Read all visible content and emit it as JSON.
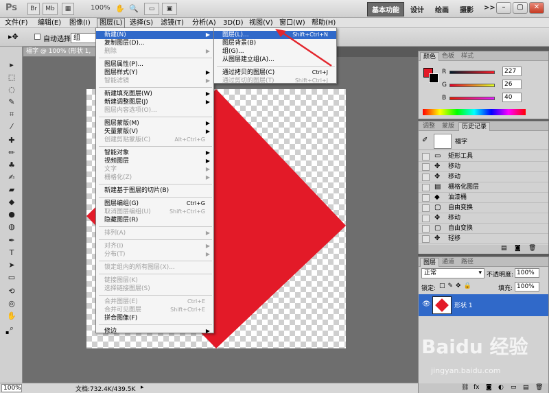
{
  "app": {
    "logo": "Ps",
    "zoom": "100%",
    "workspaces": [
      "基本功能",
      "设计",
      "绘画",
      "摄影"
    ],
    "more": ">>"
  },
  "menubar": [
    "文件(F)",
    "编辑(E)",
    "图像(I)",
    "图层(L)",
    "选择(S)",
    "滤镜(T)",
    "分析(A)",
    "3D(D)",
    "视图(V)",
    "窗口(W)",
    "帮助(H)"
  ],
  "options": {
    "auto_select_label": "自动选择:",
    "auto_select_value": "组"
  },
  "document": {
    "tab_title": "福字 @ 100% (形状 1,",
    "zoom": "100%",
    "doc_info": "文档:732.4K/439.5K"
  },
  "layer_menu": [
    {
      "label": "新建(N)",
      "arrow": true,
      "highlight": true
    },
    {
      "label": "复制图层(D)..."
    },
    {
      "label": "删除",
      "arrow": true,
      "disabled": true
    },
    {
      "sep": true
    },
    {
      "label": "图层属性(P)..."
    },
    {
      "label": "图层样式(Y)",
      "arrow": true
    },
    {
      "label": "智能滤镜",
      "arrow": true,
      "disabled": true
    },
    {
      "sep": true
    },
    {
      "label": "新建填充图层(W)",
      "arrow": true
    },
    {
      "label": "新建调整图层(J)",
      "arrow": true
    },
    {
      "label": "图层内容选项(O)...",
      "disabled": true
    },
    {
      "sep": true
    },
    {
      "label": "图层蒙版(M)",
      "arrow": true
    },
    {
      "label": "矢量蒙版(V)",
      "arrow": true
    },
    {
      "label": "创建剪贴蒙版(C)",
      "shortcut": "Alt+Ctrl+G",
      "disabled": true
    },
    {
      "sep": true
    },
    {
      "label": "智能对象",
      "arrow": true
    },
    {
      "label": "视频图层",
      "arrow": true
    },
    {
      "label": "文字",
      "arrow": true,
      "disabled": true
    },
    {
      "label": "栅格化(Z)",
      "arrow": true,
      "disabled": true
    },
    {
      "sep": true
    },
    {
      "label": "新建基于图层的切片(B)"
    },
    {
      "sep": true
    },
    {
      "label": "图层编组(G)",
      "shortcut": "Ctrl+G"
    },
    {
      "label": "取消图层编组(U)",
      "shortcut": "Shift+Ctrl+G",
      "disabled": true
    },
    {
      "label": "隐藏图层(R)"
    },
    {
      "sep": true
    },
    {
      "label": "排列(A)",
      "arrow": true,
      "disabled": true
    },
    {
      "sep": true
    },
    {
      "label": "对齐(I)",
      "arrow": true,
      "disabled": true
    },
    {
      "label": "分布(T)",
      "arrow": true,
      "disabled": true
    },
    {
      "sep": true
    },
    {
      "label": "锁定组内的所有图层(X)...",
      "disabled": true
    },
    {
      "sep": true
    },
    {
      "label": "链接图层(K)",
      "disabled": true
    },
    {
      "label": "选择链接图层(S)",
      "disabled": true
    },
    {
      "sep": true
    },
    {
      "label": "合并图层(E)",
      "shortcut": "Ctrl+E",
      "disabled": true
    },
    {
      "label": "合并可见图层",
      "shortcut": "Shift+Ctrl+E",
      "disabled": true
    },
    {
      "label": "拼合图像(F)"
    },
    {
      "sep": true
    },
    {
      "label": "修边",
      "arrow": true
    }
  ],
  "new_submenu": [
    {
      "label": "图层(L)...",
      "shortcut": "Shift+Ctrl+N",
      "highlight": true
    },
    {
      "label": "图层背景(B)"
    },
    {
      "label": "组(G)..."
    },
    {
      "label": "从图层建立组(A)..."
    },
    {
      "sep": true
    },
    {
      "label": "通过拷贝的图层(C)",
      "shortcut": "Ctrl+J"
    },
    {
      "label": "通过剪切的图层(T)",
      "shortcut": "Shift+Ctrl+J",
      "disabled": true
    }
  ],
  "color_panel": {
    "tabs": [
      "颜色",
      "色板",
      "样式"
    ],
    "channels": [
      {
        "label": "R",
        "value": "227"
      },
      {
        "label": "G",
        "value": "26"
      },
      {
        "label": "B",
        "value": "40"
      }
    ],
    "fg": "#e31a28"
  },
  "history_panel": {
    "tabs": [
      "调整",
      "蒙版",
      "历史记录"
    ],
    "snapshot": "福字",
    "items": [
      "矩形工具",
      "移动",
      "移动",
      "栅格化图层",
      "油漆桶",
      "自由变换",
      "移动",
      "自由变换",
      "轻移"
    ]
  },
  "layers_panel": {
    "tabs": [
      "图层",
      "通道",
      "路径"
    ],
    "blend": "正常",
    "opacity_label": "不透明度:",
    "opacity": "100%",
    "lock_label": "锁定:",
    "fill_label": "填充:",
    "fill": "100%",
    "layer_name": "形状 1"
  },
  "watermark": {
    "text": "Baidu 经验",
    "url": "jingyan.baidu.com"
  }
}
